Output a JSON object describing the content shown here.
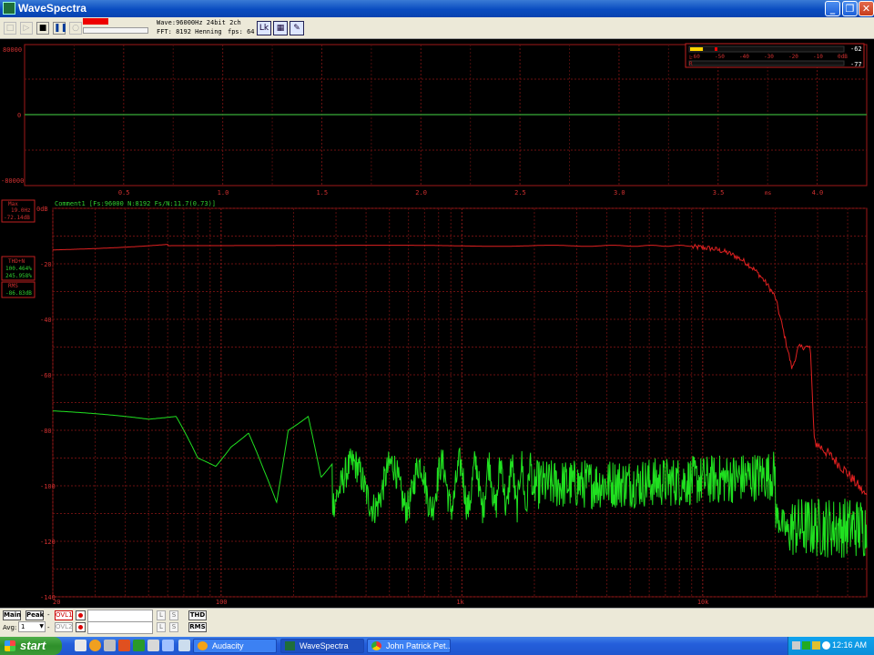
{
  "window": {
    "title": "WaveSpectra"
  },
  "toolbar": {
    "info_wave": "Wave:96000Hz 24bit 2ch",
    "info_fft": "FFT: 8192 Henning",
    "info_fps": "fps: 64",
    "icons": [
      "new-icon",
      "open-icon",
      "play-icon",
      "stop-icon",
      "pause-icon",
      "record-icon"
    ]
  },
  "wave": {
    "y_top": "80000",
    "y_mid": "0",
    "y_bottom": "-80000",
    "x_ticks": [
      "0.5",
      "1.0",
      "1.5",
      "2.0",
      "2.5",
      "3.0",
      "3.5",
      "4.0"
    ],
    "x_unit": "ms",
    "meter": {
      "ticks": [
        "-60",
        "-50",
        "-40",
        "-30",
        "-20",
        "-10",
        "0dB"
      ],
      "peak_l": "-62",
      "peak_r": "-77",
      "level_l": 0.06,
      "level_r": 0
    }
  },
  "spectrum": {
    "comment": "Comment1  [Fs:96000 N:8192 Fs/N:11.7(0.73)]",
    "y_ticks": [
      "0dB",
      "-20",
      "-40",
      "-60",
      "-80",
      "-100",
      "-120",
      "-140"
    ],
    "x_ticks": [
      "20",
      "100",
      "1k",
      "10k"
    ],
    "max_label": "Max",
    "max_freq": "19.0Hz",
    "max_db": "-72.14dB",
    "thd_label": "THD+N",
    "thd_1": "100.464%",
    "thd_2": "245.958%",
    "rms_label": "RMS",
    "rms_value": "-86.83dB",
    "colors": {
      "left": "#e02020",
      "right": "#20e020",
      "grid": "#7a1010"
    }
  },
  "bottom": {
    "main_btn": "Main",
    "peak_btn": "Peak",
    "dash": "-",
    "ovl1": "OVL1",
    "ovl2": "OVL2",
    "avg_label": "Avg:",
    "avg_value": "1",
    "l_label": "L",
    "s_label": "S",
    "thd_btn": "THD",
    "rms_btn": "RMS"
  },
  "taskbar": {
    "start": "start",
    "tasks": [
      "Audacity",
      "WaveSpectra",
      "John Patrick Pet..."
    ],
    "clock": "12:16 AM"
  }
}
